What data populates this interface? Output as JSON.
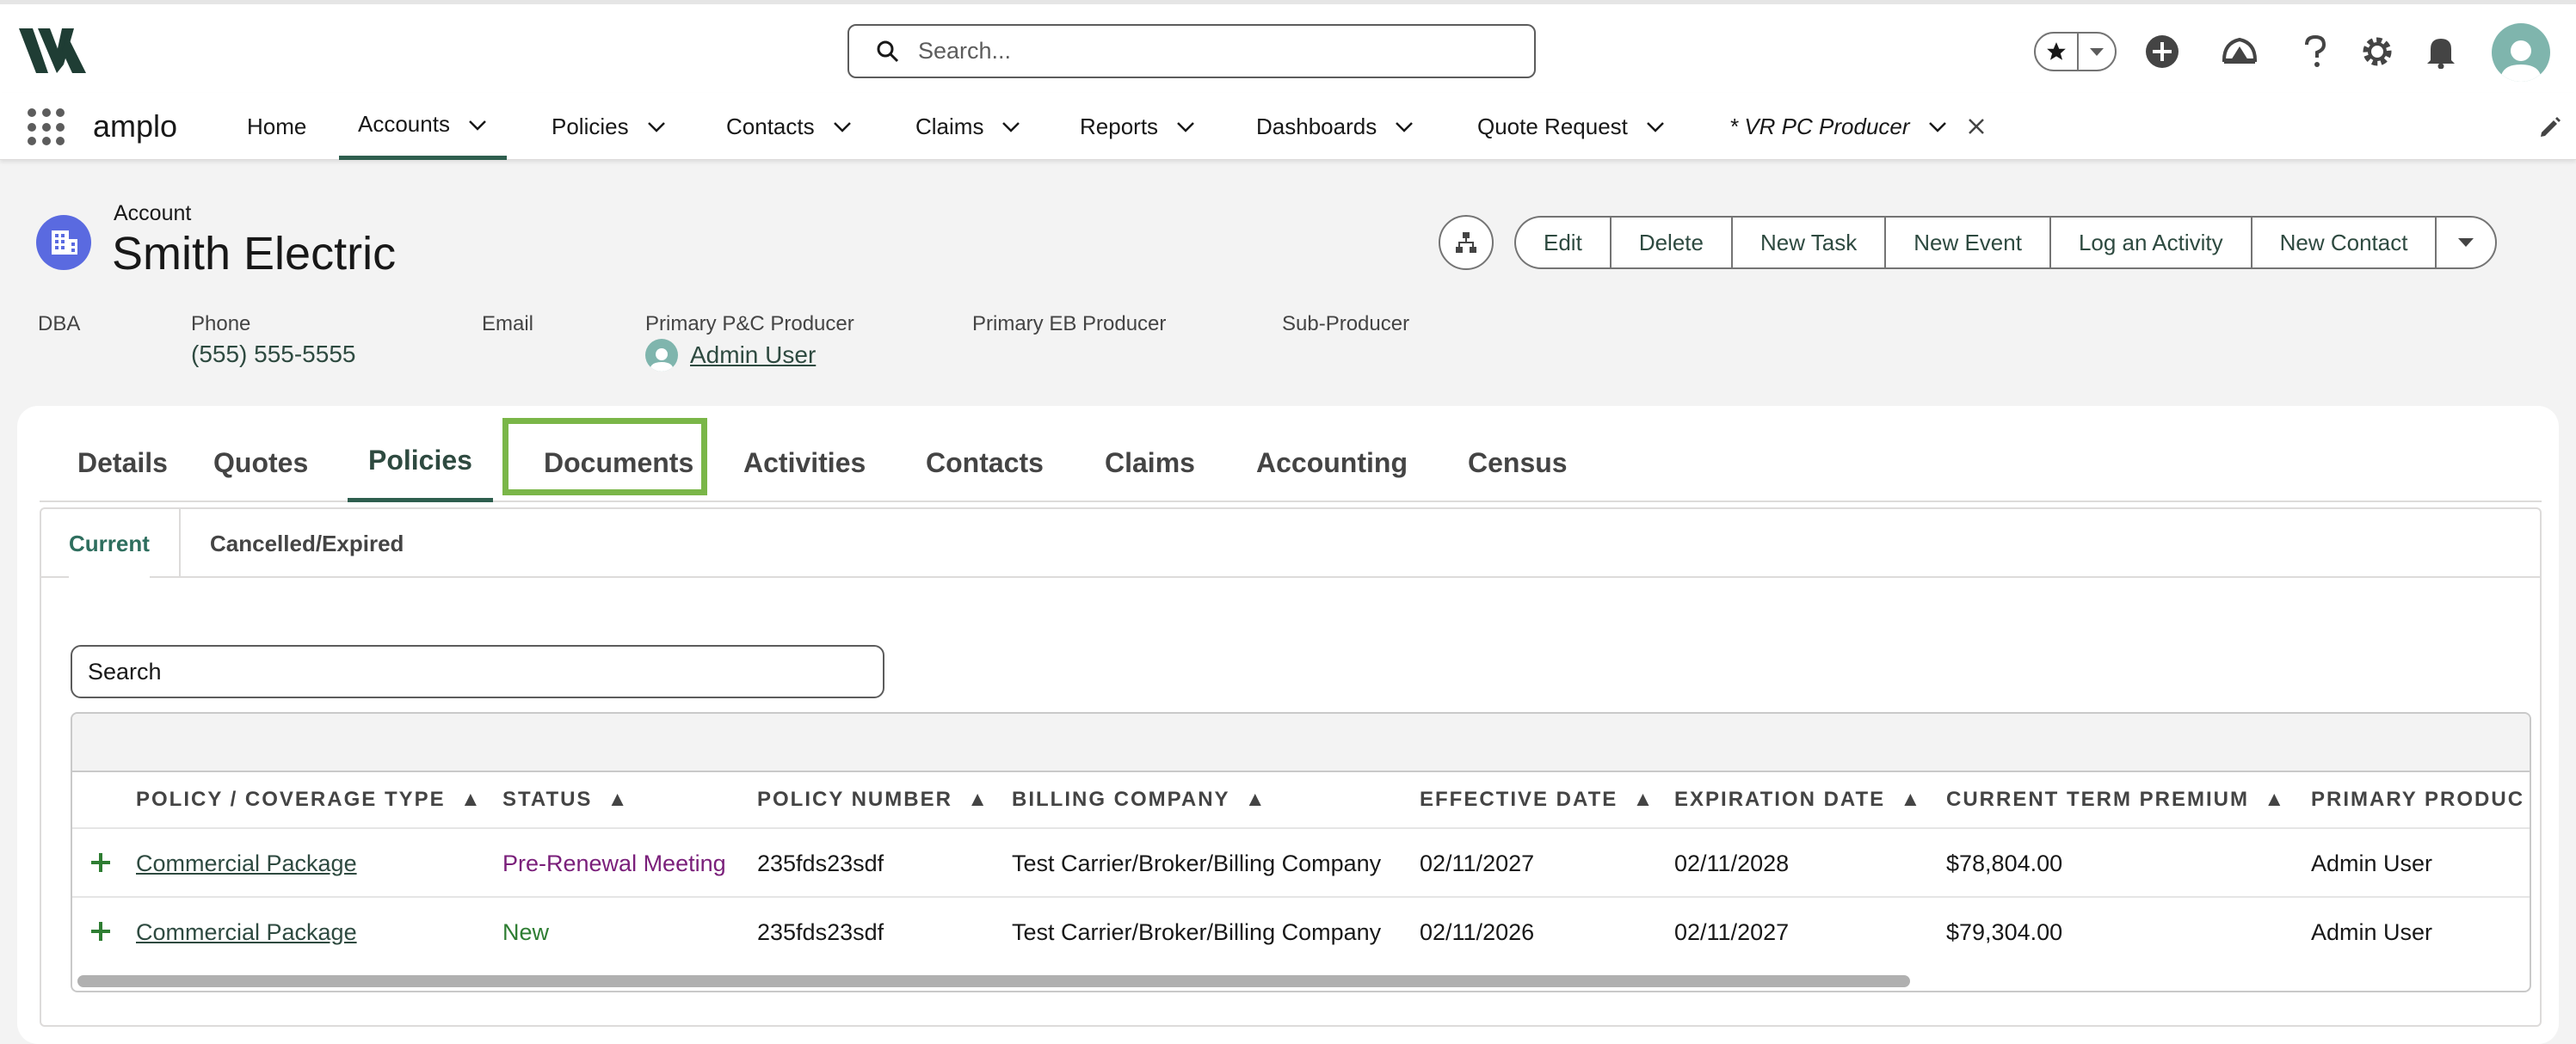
{
  "header": {
    "search_placeholder": "Search..."
  },
  "nav": {
    "app_name": "amplo",
    "items": [
      {
        "label": "Home"
      },
      {
        "label": "Accounts"
      },
      {
        "label": "Policies"
      },
      {
        "label": "Contacts"
      },
      {
        "label": "Claims"
      },
      {
        "label": "Reports"
      },
      {
        "label": "Dashboards"
      },
      {
        "label": "Quote Request"
      },
      {
        "label": "* VR PC Producer"
      }
    ]
  },
  "record": {
    "type_label": "Account",
    "title": "Smith Electric",
    "actions": [
      "Edit",
      "Delete",
      "New Task",
      "New Event",
      "Log an Activity",
      "New Contact"
    ],
    "fields": {
      "dba_label": "DBA",
      "phone_label": "Phone",
      "phone_value": "(555) 555-5555",
      "email_label": "Email",
      "pc_producer_label": "Primary P&C Producer",
      "pc_producer_value": "Admin User",
      "eb_producer_label": "Primary EB Producer",
      "sub_producer_label": "Sub-Producer"
    }
  },
  "tabs": [
    "Details",
    "Quotes",
    "Policies",
    "Documents",
    "Activities",
    "Contacts",
    "Claims",
    "Accounting",
    "Census"
  ],
  "subtabs": [
    "Current",
    "Cancelled/Expired"
  ],
  "list": {
    "search_placeholder": "Search",
    "columns": [
      "POLICY / COVERAGE TYPE",
      "STATUS",
      "POLICY NUMBER",
      "BILLING COMPANY",
      "EFFECTIVE DATE",
      "EXPIRATION DATE",
      "CURRENT TERM PREMIUM",
      "PRIMARY PRODUC"
    ],
    "sort_indicator": "▲",
    "rows": [
      {
        "type": "Commercial Package",
        "status": "Pre-Renewal Meeting",
        "policy_number": "235fds23sdf",
        "billing": "Test Carrier/Broker/Billing Company",
        "effective": "02/11/2027",
        "expiration": "02/11/2028",
        "premium": "$78,804.00",
        "producer": "Admin User"
      },
      {
        "type": "Commercial Package",
        "status": "New",
        "policy_number": "235fds23sdf",
        "billing": "Test Carrier/Broker/Billing Company",
        "effective": "02/11/2026",
        "expiration": "02/11/2027",
        "premium": "$79,304.00",
        "producer": "Admin User"
      }
    ]
  },
  "colors": {
    "brand_green": "#2e5e4e",
    "status_pre_renewal": "#7a1f7a",
    "status_new": "#2e7d32",
    "highlight": "#7ab648"
  }
}
